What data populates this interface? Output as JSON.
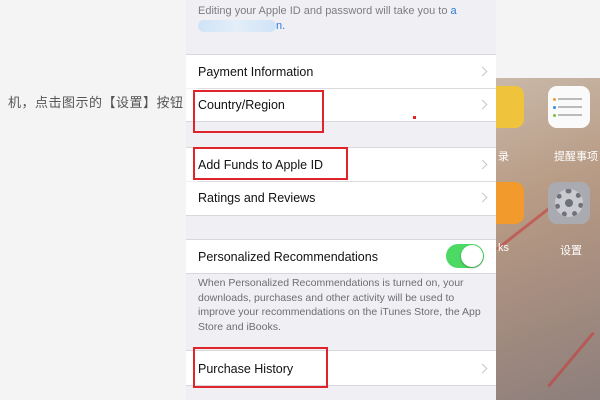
{
  "background": {
    "article_text": "机，点击图示的【设置】按钮",
    "apps": [
      {
        "label": "录",
        "icon": "notes-icon"
      },
      {
        "label": "提醒事项",
        "icon": "reminders-icon"
      },
      {
        "label": "ks",
        "icon": "ibooks-icon"
      },
      {
        "label": "设置",
        "icon": "settings-gear-icon"
      }
    ]
  },
  "settings": {
    "top_note_prefix": "Editing your Apple ID and password will take you to",
    "top_note_link_start": "a",
    "top_note_link_end": "n.",
    "rows": {
      "payment": "Payment Information",
      "country": "Country/Region",
      "add_funds": "Add Funds to Apple ID",
      "ratings": "Ratings and Reviews",
      "personalized": "Personalized Recommendations",
      "purchase_history": "Purchase History"
    },
    "personalized_toggle_on": true,
    "footer_note": "When Personalized Recommendations is turned on, your downloads, purchases and other activity will be used to improve your recommendations on the iTunes Store, the App Store and iBooks."
  },
  "colors": {
    "highlight": "#e0242c",
    "toggle_on": "#4cd964",
    "link": "#2a7ad9"
  }
}
